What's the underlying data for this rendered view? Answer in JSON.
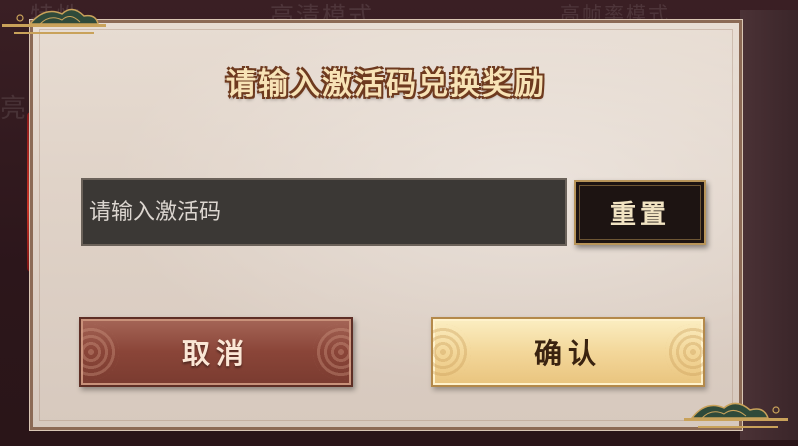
{
  "dialog": {
    "title": "请输入激活码兑换奖励",
    "input": {
      "value": "",
      "placeholder": "请输入激活码"
    },
    "reset_label": "重置",
    "cancel_label": "取消",
    "confirm_label": "确认"
  },
  "background": {
    "texts": [
      "高清模式",
      "高帧率模式",
      "亮度",
      "特性"
    ]
  },
  "colors": {
    "title_fill": "#f7e3b6",
    "title_outline": "#6e3a1f",
    "input_bg": "#3b3835",
    "reset_bg": "#1d1412",
    "cancel_bg": "#8a4538",
    "confirm_bg": "#f3d79a"
  },
  "icons": {
    "top_left": "pine-cloud-ornament-icon",
    "bottom_right": "pine-cloud-ornament-icon"
  }
}
